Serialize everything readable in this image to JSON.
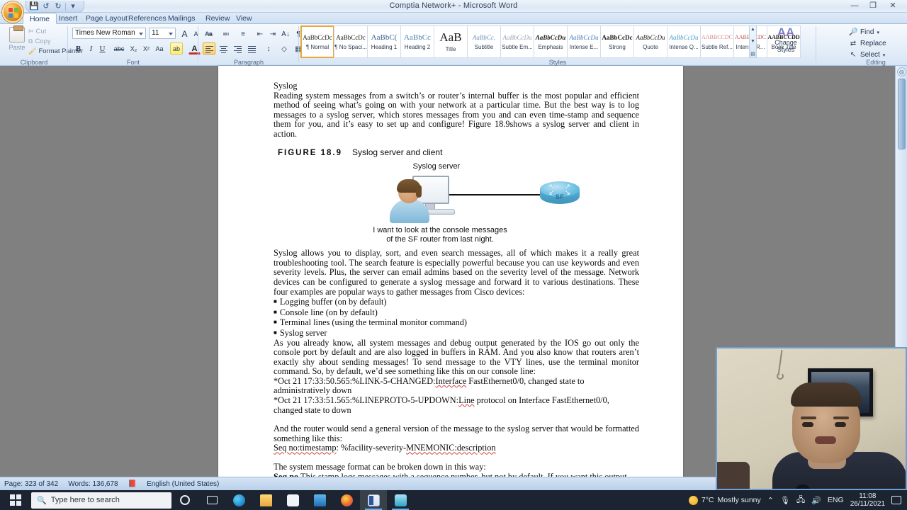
{
  "window": {
    "title": "Comptia Network+  -  Microsoft Word",
    "minimize": "—",
    "maximize": "❐",
    "close": "✕"
  },
  "quick_access": {
    "save": "💾",
    "undo": "↺",
    "redo": "↻",
    "customize": "▾"
  },
  "ribbon": {
    "tabs": [
      {
        "label": "Home",
        "active": true
      },
      {
        "label": "Insert",
        "active": false
      },
      {
        "label": "Page Layout",
        "active": false
      },
      {
        "label": "References",
        "active": false
      },
      {
        "label": "Mailings",
        "active": false
      },
      {
        "label": "Review",
        "active": false
      },
      {
        "label": "View",
        "active": false
      }
    ],
    "clipboard": {
      "group_label": "Clipboard",
      "paste": "Paste",
      "cut": "Cut",
      "copy": "Copy",
      "format_painter": "Format Painter"
    },
    "font": {
      "group_label": "Font",
      "font_name": "Times New Roman",
      "font_size": "11",
      "grow_font": "A",
      "shrink_font": "A",
      "clear_formatting": "Aa",
      "bold": "B",
      "italic": "I",
      "underline": "U",
      "strikethrough": "abc",
      "subscript": "X₂",
      "superscript": "X²",
      "change_case": "Aa",
      "highlight": "ab",
      "font_color": "A"
    },
    "paragraph": {
      "group_label": "Paragraph",
      "bullets": "≔",
      "numbering": "≕",
      "multilevel": "≡",
      "decrease_indent": "⇤",
      "increase_indent": "⇥",
      "sort": "A↓",
      "show_marks": "¶",
      "align_left": "▤",
      "align_center": "▤",
      "align_right": "▤",
      "justify": "▤",
      "line_spacing": "↕",
      "shading": "◇",
      "borders": "▦"
    },
    "styles": {
      "group_label": "Styles",
      "items": [
        {
          "preview": "AaBbCcDc",
          "name": "¶ Normal",
          "selected": true
        },
        {
          "preview": "AaBbCcDc",
          "name": "¶ No Spaci...",
          "selected": false
        },
        {
          "preview": "AaBbC(",
          "name": "Heading 1",
          "selected": false
        },
        {
          "preview": "AaBbCc",
          "name": "Heading 2",
          "selected": false
        },
        {
          "preview": "AaB",
          "name": "Title",
          "selected": false
        },
        {
          "preview": "AaBbCc.",
          "name": "Subtitle",
          "selected": false
        },
        {
          "preview": "AaBbCcDu",
          "name": "Subtle Em...",
          "selected": false
        },
        {
          "preview": "AaBbCcDu",
          "name": "Emphasis",
          "selected": false
        },
        {
          "preview": "AaBbCcDu",
          "name": "Intense E...",
          "selected": false
        },
        {
          "preview": "AaBbCcDc",
          "name": "Strong",
          "selected": false
        },
        {
          "preview": "AaBbCcDu",
          "name": "Quote",
          "selected": false
        },
        {
          "preview": "AaBbCcDu",
          "name": "Intense Q...",
          "selected": false
        },
        {
          "preview": "AABBCCDC",
          "name": "Subtle Ref...",
          "selected": false
        },
        {
          "preview": "AABBCCDC",
          "name": "Intense R...",
          "selected": false
        },
        {
          "preview": "AABBCCDD",
          "name": "Book Title",
          "selected": false
        }
      ],
      "change_styles_line1": "Change",
      "change_styles_line2": "Styles",
      "scroll_up": "▲",
      "scroll_down": "▼",
      "scroll_more": "▤"
    },
    "editing": {
      "group_label": "Editing",
      "find": "Find",
      "replace": "Replace",
      "select": "Select"
    }
  },
  "document": {
    "heading": "Syslog",
    "para1": "Reading system messages from a switch’s or router’s internal buffer is the most popular and efficient method of seeing what’s going on with your network at a particular time. But the best way is to log messages to a syslog server, which stores messages from you and can even time-stamp and sequence them for you, and it’s easy to set up and configure! Figure 18.9shows a syslog server and client in action.",
    "figure_number": "FIGURE 18.9",
    "figure_title": "Syslog server and client",
    "figure": {
      "server_label": "Syslog server",
      "router_label": "SF",
      "quote_line1": "I want to look at the console messages",
      "quote_line2": "of the SF router from last night."
    },
    "para2": "Syslog allows you to display, sort, and even search messages, all of which makes it a really great troubleshooting tool. The search feature is especially powerful because you can use keywords and even severity levels. Plus, the server can email admins based on the severity level of the message. Network devices can be configured to generate a syslog message and forward it to various destinations. These four examples are popular ways to gather messages from Cisco devices:",
    "bullets": [
      "Logging buffer (on by default)",
      "Console line (on by default)",
      "Terminal lines (using the terminal monitor command)",
      "Syslog server"
    ],
    "bullet_marker": "■",
    "para3": "As you already know, all system messages and debug output generated by the IOS go out only the console port by default and are also logged in buffers in RAM. And you also know that routers aren’t exactly shy about sending messages! To send message to the VTY lines, use the terminal monitor command. So, by default, we’d see something like this on our console line:",
    "log1_pre": "*Oct 21 17:33:50.565:%LINK-5-CHANGED:",
    "log1_spell": "Interface",
    "log1_post": " FastEthernet0/0, changed state to administratively down",
    "log2_pre": "*Oct 21 17:33:51.565:%LINEPROTO-5-UPDOWN:",
    "log2_spell": "Line",
    "log2_post": " protocol on Interface FastEthernet0/0, changed state to down",
    "para4": "And the router would send a general version of the message to the syslog server that would be formatted something like this:",
    "format_line_a": "Seq no:timestamp",
    "format_line_b": ": %facility-severity-",
    "format_line_c": "MNEMONIC:description",
    "para5": "The system message format can be broken down in this way:",
    "seq_no_label": "Seq no",
    "seq_no_text": " This stamp logs messages with a sequence number, but not by default. If you want this output, you’ve got to configure it."
  },
  "status_bar": {
    "page": "Page: 323 of 342",
    "words": "Words: 136,678",
    "proofing_icon": "proofing-errors-icon",
    "language": "English (United States)"
  },
  "scrollbar": {
    "select_browse_object": "◎",
    "up": "▲",
    "down": "▼"
  },
  "taskbar": {
    "start": "start-icon",
    "search_placeholder": "Type here to search",
    "search_icon": "🔍",
    "cortana": "cortana-icon",
    "task_view": "task-view-icon",
    "apps": [
      {
        "name": "edge",
        "label": "Microsoft Edge",
        "color": "#27a3dd",
        "open": false
      },
      {
        "name": "file-explorer",
        "label": "File Explorer",
        "color": "#f5c24b",
        "open": false
      },
      {
        "name": "microsoft-store",
        "label": "Microsoft Store",
        "color": "#f0f4f8",
        "open": false
      },
      {
        "name": "mail",
        "label": "Mail",
        "color": "#2d8ed6",
        "open": false
      },
      {
        "name": "firefox",
        "label": "Firefox",
        "color": "#ef6c2a",
        "open": false
      },
      {
        "name": "word",
        "label": "Microsoft Word",
        "color": "#2b579a",
        "open": true
      },
      {
        "name": "media-app",
        "label": "Media App",
        "color": "#2fa3c7",
        "open": true
      }
    ],
    "tray": {
      "temperature": "7°C",
      "weather": "Mostly sunny",
      "overflow": "⌃",
      "microphone": "🎙",
      "network": "🖧",
      "volume": "🔊",
      "language": "ENG",
      "time": "11:08",
      "date": "26/11/2021",
      "action_center": "notification-icon"
    }
  },
  "colors": {
    "word_accent": "#2b579a",
    "ribbon_highlight": "#ffd978",
    "taskbar_bg": "#1b2430",
    "router_blue": "#57b0d6"
  }
}
